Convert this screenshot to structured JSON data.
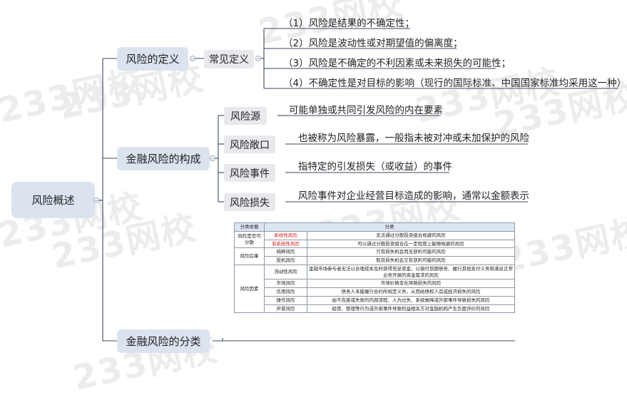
{
  "root": "风险概述",
  "branches": {
    "definition": {
      "label": "风险的定义",
      "sub": "常见定义",
      "items": [
        "（1）风险是结果的不确定性；",
        "（2）风险是波动性或对期望值的偏离度；",
        "（3）风险是不确定的不利因素或未来损失的可能性；",
        "（4）不确定性是对目标的影响（现行的国际标准、中国国家标准均采用这一种）"
      ]
    },
    "composition": {
      "label": "金融风险的构成",
      "items": [
        {
          "name": "风险源",
          "desc": "可能单独或共同引发风险的内在要素"
        },
        {
          "name": "风险敞口",
          "desc": "也被称为风险暴露，一般指未被对冲或未加保护的风险"
        },
        {
          "name": "风险事件",
          "desc": "指特定的引发损失（或收益）的事件"
        },
        {
          "name": "风险损失",
          "desc": "风险事件对企业经营目标造成的影响，通常以金额表示"
        }
      ]
    },
    "classification": {
      "label": "金融风险的分类",
      "table": {
        "headers": [
          "分类依据",
          "分类"
        ],
        "groups": [
          {
            "basis": "风险是否可分散",
            "rows": [
              {
                "type": "系统性风险",
                "desc": "无法通过分散投资组合规避的风险",
                "highlight": true
              },
              {
                "type": "非系统性风险",
                "desc": "可以通过分散投资组合在一定程度上能够规避的风险",
                "highlight": true
              }
            ]
          },
          {
            "basis": "风险后果",
            "rows": [
              {
                "type": "纯粹风险",
                "desc": "只有损失机会而无获利可能的风险"
              },
              {
                "type": "投机风险",
                "desc": "既有损失机会又有获利可能的风险"
              }
            ]
          },
          {
            "basis": "风险因素",
            "rows": [
              {
                "type": "流动性风险",
                "desc": "金融市场参与者无法以合理成本及时获得充足资金，以偿付到期债务、履行其他支付义务和满足正常业务开展的资金需求的风险"
              },
              {
                "type": "市场风险",
                "desc": "市场价格变化导致损失的风险"
              },
              {
                "type": "信用风险",
                "desc": "债务人未能履行合约所规定义务，从而给债权人造成经济损失的风险"
              },
              {
                "type": "操作风险",
                "desc": "由不完善或失败的内部流程、人为过失、系统故障或外部事件导致损失的风险"
              },
              {
                "type": "声誉风险",
                "desc": "经营、管理等行为或外部事件导致利益相关方对金融机构产生负面评价的风险"
              }
            ]
          }
        ]
      }
    }
  },
  "watermark": "233网校",
  "colors": {
    "line": "#3a4a5e",
    "node": "#dbe3ef",
    "subnode": "#e7e9ec",
    "table_header": "#dce6f2",
    "highlight": "#d11111"
  }
}
